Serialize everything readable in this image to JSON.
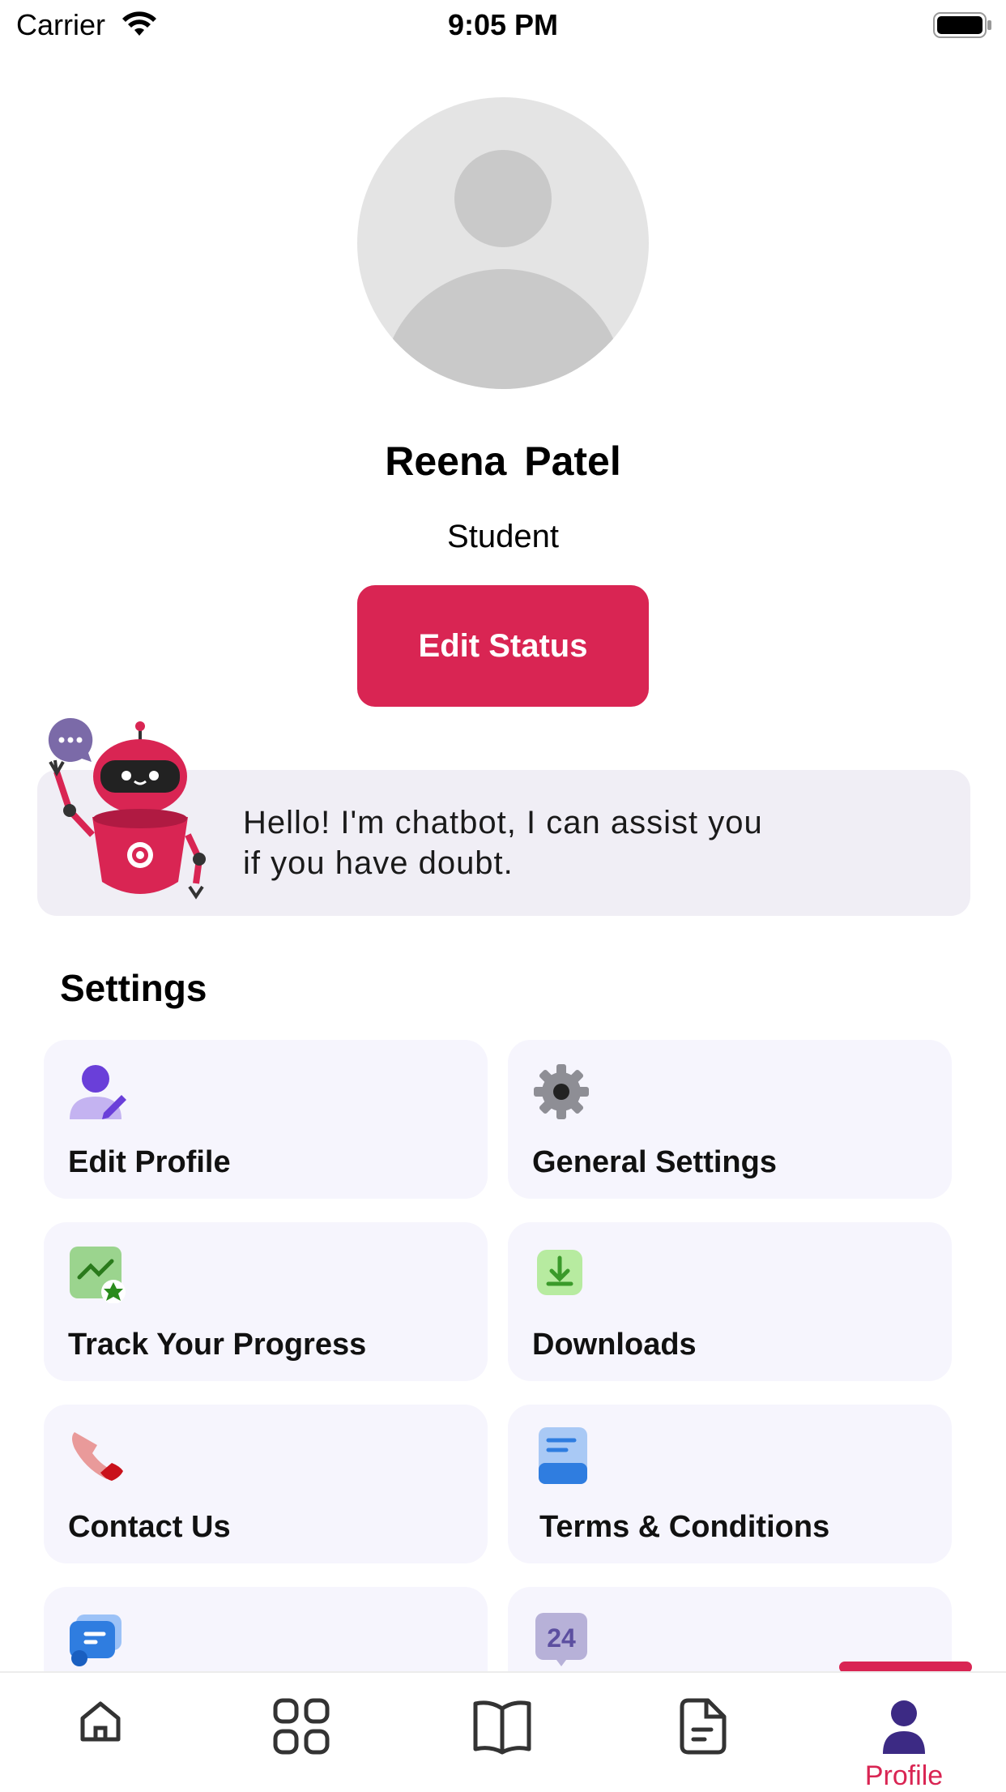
{
  "status_bar": {
    "carrier": "Carrier",
    "time": "9:05 PM"
  },
  "profile": {
    "name": "Reena  Patel",
    "role": "Student",
    "edit_button": "Edit Status"
  },
  "chatbot": {
    "message_line1": "Hello! I'm chatbot, I can assist you",
    "message_line2": "if you have doubt."
  },
  "settings": {
    "title": "Settings",
    "items": [
      {
        "label": "Edit Profile",
        "icon": "edit-profile-icon"
      },
      {
        "label": "General Settings",
        "icon": "gear-icon"
      },
      {
        "label": "Track Your Progress",
        "icon": "progress-chart-icon"
      },
      {
        "label": "Downloads",
        "icon": "download-icon"
      },
      {
        "label": "Contact Us",
        "icon": "phone-icon"
      },
      {
        "label": "Terms & Conditions",
        "icon": "document-icon"
      },
      {
        "label": "",
        "icon": "support-card-icon"
      },
      {
        "label": "",
        "icon": "24-hours-icon"
      }
    ]
  },
  "bottom_nav": {
    "items": [
      {
        "icon": "home-icon"
      },
      {
        "icon": "grid-icon"
      },
      {
        "icon": "book-icon"
      },
      {
        "icon": "file-icon"
      },
      {
        "icon": "profile-icon",
        "label": "Profile",
        "active": true
      }
    ]
  },
  "colors": {
    "accent": "#d92553",
    "tile_bg": "#f6f5fd",
    "chat_bg": "#f0eef5"
  }
}
